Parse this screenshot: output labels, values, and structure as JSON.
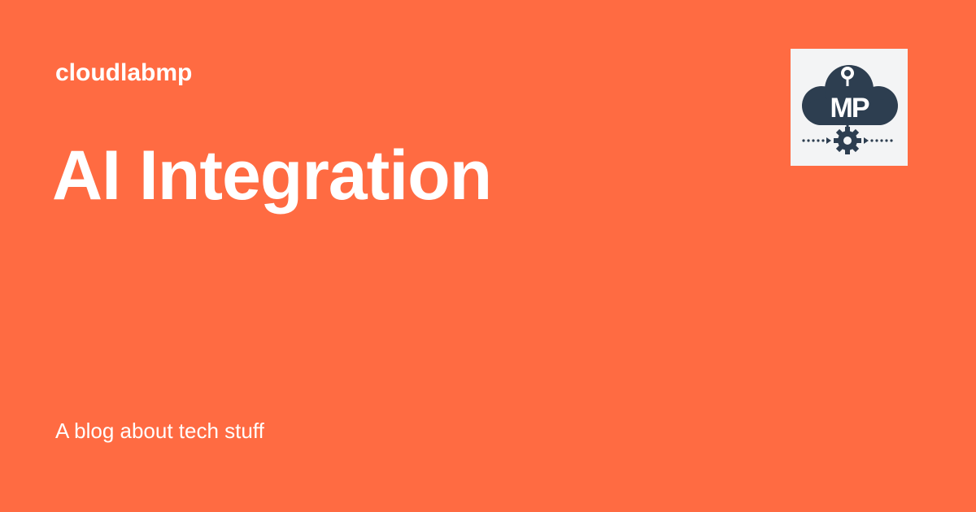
{
  "site": {
    "name": "cloudlabmp",
    "tagline": "A blog about tech stuff"
  },
  "post": {
    "title": "AI Integration"
  },
  "logo": {
    "text": "MP",
    "icon": "cloud-gear-logo-icon"
  },
  "colors": {
    "background": "#ff6b42",
    "text": "#ffffff",
    "logo_background": "#f3f4f5",
    "logo_dark": "#2d3e50"
  }
}
